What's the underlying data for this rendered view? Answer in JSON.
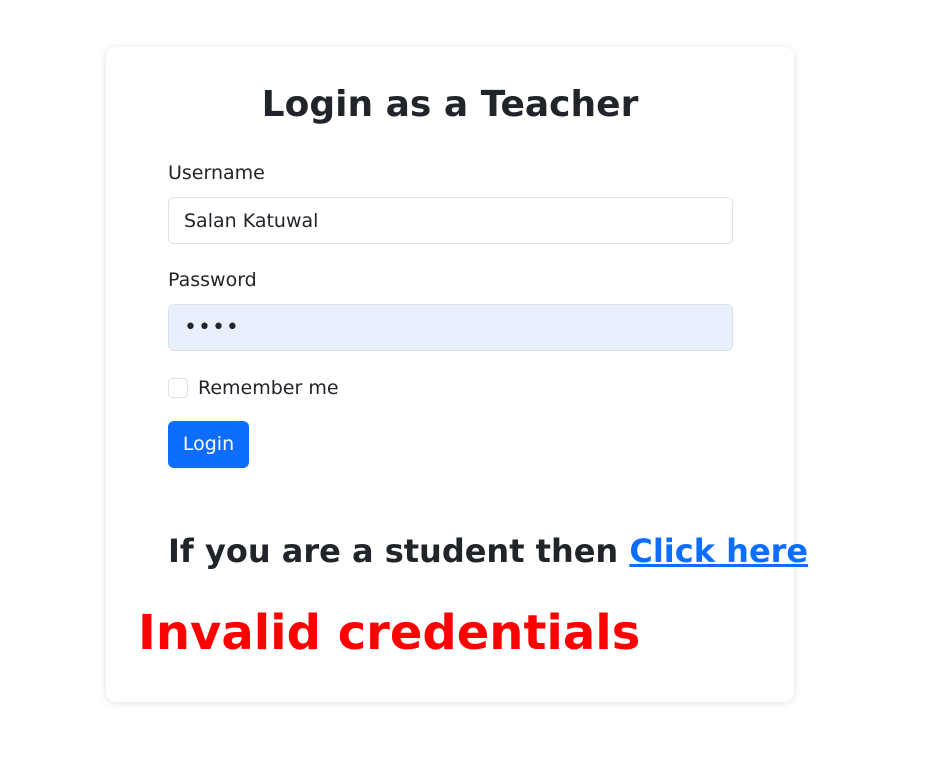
{
  "login": {
    "title": "Login as a Teacher",
    "username_label": "Username",
    "username_value": "Salan Katuwal",
    "password_label": "Password",
    "password_value": "••••",
    "remember_label": "Remember me",
    "remember_checked": false,
    "login_button": "Login"
  },
  "student": {
    "prefix": "If you are a student then ",
    "link_text": "Click here"
  },
  "error": {
    "message": "Invalid credentials"
  },
  "colors": {
    "primary": "#0d6efd",
    "error": "#ff0000",
    "autofill_bg": "#e8f0fe"
  }
}
